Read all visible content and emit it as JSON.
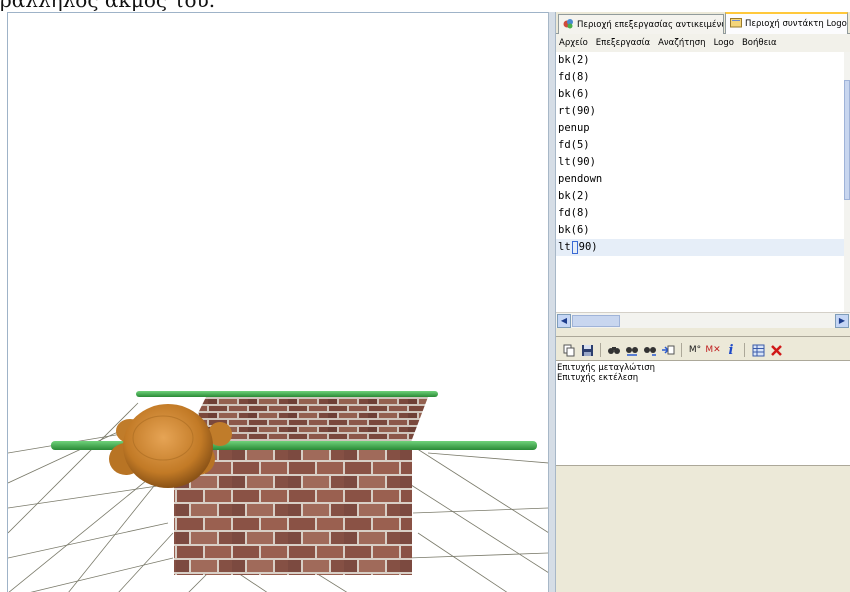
{
  "caption": "ραλληλος ακμος του.",
  "tabs": [
    {
      "label": "Περιοχή επεξεργασίας αντικειμένων",
      "icon": "objects-icon"
    },
    {
      "label": "Περιοχή συντάκτη Logo",
      "icon": "editor-icon"
    }
  ],
  "menu": [
    "Αρχείο",
    "Επεξεργασία",
    "Αναζήτηση",
    "Logo",
    "Βοήθεια"
  ],
  "code_lines": [
    "bk(2)",
    "fd(8)",
    "bk(6)",
    "rt(90)",
    "penup",
    "fd(5)",
    "lt(90)",
    "pendown",
    "bk(2)",
    "fd(8)",
    "bk(6)"
  ],
  "current_line": {
    "before": "lt",
    "after": "90)"
  },
  "toolbar_buttons": [
    "copy-icon",
    "save-icon",
    "find-icon",
    "find-previous-icon",
    "find-next-icon",
    "goto-line-icon",
    "memory-icon",
    "memory-clear-icon",
    "info-icon",
    "table-icon",
    "close-icon"
  ],
  "toolbar_labels": {
    "memory": "M°",
    "memory_clear": "M✕",
    "info": "i"
  },
  "output_lines": [
    "Επιτυχής μεταγλώτιση",
    "Επιτυχής εκτέλεση"
  ],
  "colors": {
    "accent_tab": "#ffc83c",
    "rod_green": "#3fae4a",
    "turtle": "#c9822a",
    "brick": "#8c5a4d"
  }
}
